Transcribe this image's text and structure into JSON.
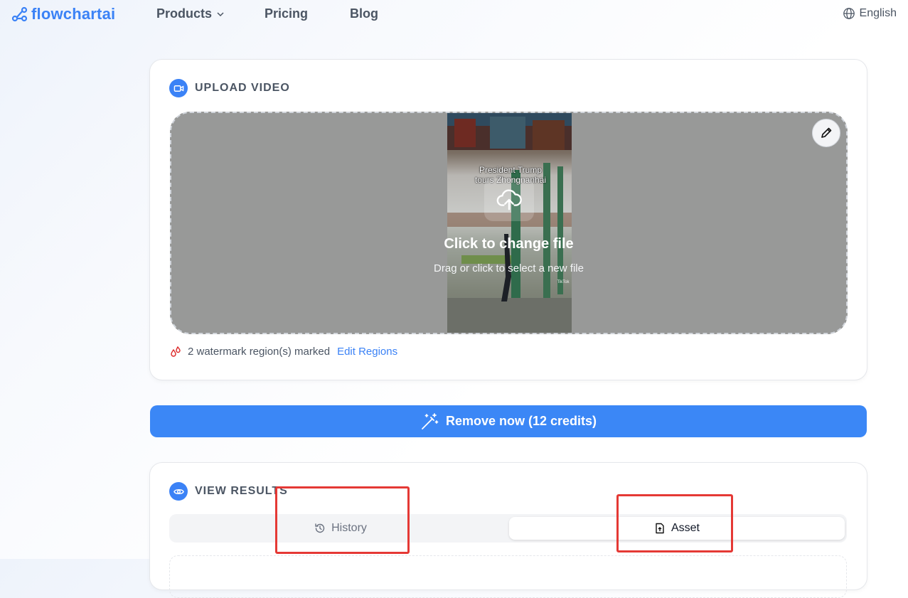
{
  "nav": {
    "logo_text": "flowchartai",
    "items": [
      {
        "label": "Products",
        "has_dropdown": true
      },
      {
        "label": "Pricing"
      },
      {
        "label": "Blog"
      }
    ],
    "language": "English"
  },
  "upload": {
    "section_title": "UPLOAD VIDEO",
    "video_caption": "President Trump tours Zhongnanhai",
    "change_title": "Click to change file",
    "change_subtitle": "Drag or click to select a new file",
    "tiktok_mark": "TikTok",
    "marked_text": "2 watermark region(s) marked",
    "edit_regions_label": "Edit Regions"
  },
  "remove_button": {
    "label": "Remove now (12 credits)"
  },
  "results": {
    "section_title": "VIEW RESULTS",
    "tabs": [
      {
        "label": "History",
        "icon": "history-icon",
        "selected": false
      },
      {
        "label": "Asset",
        "icon": "file-upload-icon",
        "selected": true
      }
    ]
  },
  "colors": {
    "accent": "#3b82f6",
    "annotation": "#e53935",
    "dropzone_bg": "#989998"
  }
}
